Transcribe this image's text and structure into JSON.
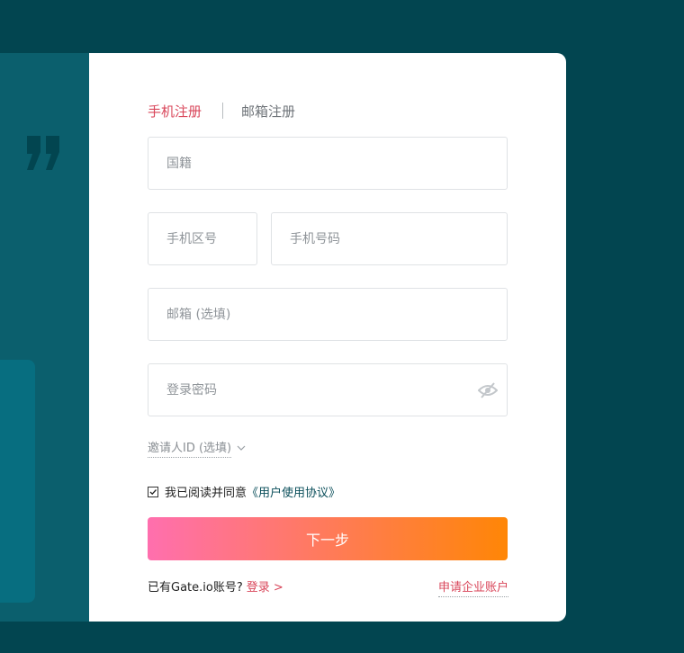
{
  "tabs": {
    "phone": "手机注册",
    "email": "邮箱注册"
  },
  "fields": {
    "nationality_placeholder": "国籍",
    "area_code_placeholder": "手机区号",
    "phone_placeholder": "手机号码",
    "email_placeholder": "邮箱 (选填)",
    "password_placeholder": "登录密码"
  },
  "invite": {
    "label": "邀请人ID (选填)"
  },
  "agreement": {
    "text": "我已阅读并同意",
    "link": "《用户使用协议》",
    "checked": true
  },
  "buttons": {
    "next": "下一步"
  },
  "footer": {
    "have_account": "已有Gate.io账号?",
    "login": "登录 >",
    "enterprise": "申请企业账户"
  },
  "colors": {
    "accent": "#d9465a",
    "background": "#024550",
    "gradient_start": "#ff6fae",
    "gradient_end": "#ff8606"
  },
  "icons": {
    "quote": "quote-icon",
    "eye": "eye-off-icon",
    "chevron": "chevron-down-icon",
    "check": "check-icon"
  }
}
